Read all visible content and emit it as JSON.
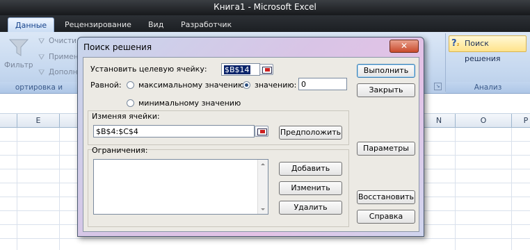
{
  "window": {
    "title": "Книга1 - Microsoft Excel"
  },
  "ribbon": {
    "tabs": [
      "Данные",
      "Рецензирование",
      "Вид",
      "Разработчик"
    ],
    "active_tab": "Данные",
    "filter_label": "Фильтр",
    "clear_label": "Очисти",
    "reapply_label": "Примен",
    "advanced_label": "Дополн",
    "sort_group_label": "ортировка и фильтр",
    "solver_label": "Поиск решения",
    "analysis_group_label": "Анализ"
  },
  "columns": [
    "E",
    "N",
    "O",
    "P"
  ],
  "dialog": {
    "title": "Поиск решения",
    "close_symbol": "✕",
    "target_label": "Установить целевую ячейку:",
    "target_value": "$B$14",
    "equal_label": "Равной:",
    "max_label": "максимальному значению",
    "value_label": "значению:",
    "value_input": "0",
    "min_label": "минимальному значению",
    "changing_label": "Изменяя ячейки:",
    "changing_value": "$B$4:$C$4",
    "guess_button": "Предположить",
    "constraints_label": "Ограничения:",
    "add_button": "Добавить",
    "change_button": "Изменить",
    "delete_button": "Удалить",
    "execute_button": "Выполнить",
    "close_button": "Закрыть",
    "params_button": "Параметры",
    "restore_button": "Восстановить",
    "help_button": "Справка",
    "selected_radio": "value"
  }
}
